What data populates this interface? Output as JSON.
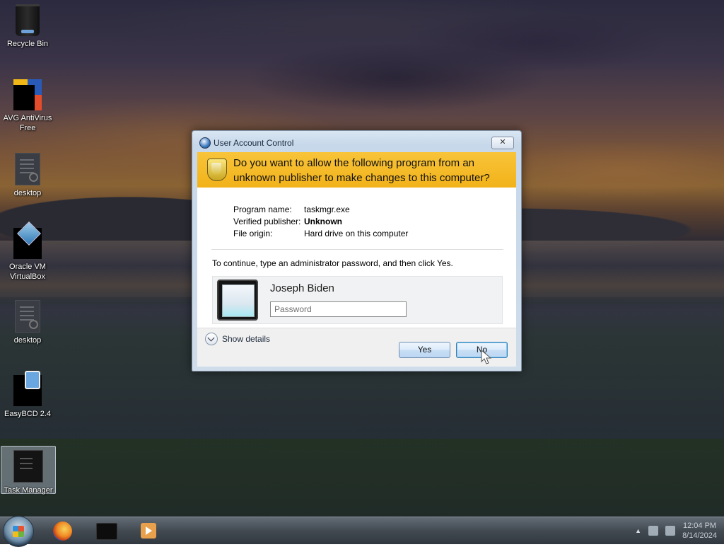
{
  "desktop": {
    "icons": [
      {
        "label": "Recycle Bin"
      },
      {
        "label": "AVG AntiVirus Free"
      },
      {
        "label": "desktop"
      },
      {
        "label": "Oracle VM VirtualBox"
      },
      {
        "label": "desktop"
      },
      {
        "label": "EasyBCD 2.4"
      },
      {
        "label": "Task Manager"
      }
    ]
  },
  "uac": {
    "title": "User Account Control",
    "close_glyph": "✕",
    "question": "Do you want to allow the following program from an unknown publisher to make changes to this computer?",
    "details": {
      "program_name_label": "Program name:",
      "program_name": "taskmgr.exe",
      "publisher_label": "Verified publisher:",
      "publisher": "Unknown",
      "origin_label": "File origin:",
      "origin": "Hard drive on this computer"
    },
    "instruction": "To continue, type an administrator password, and then click Yes.",
    "user": {
      "name": "Joseph Biden"
    },
    "password": {
      "placeholder": "Password",
      "value": ""
    },
    "show_details": "Show details",
    "yes": "Yes",
    "no": "No"
  },
  "taskbar": {
    "apps": [
      "firefox-icon",
      "virtualbox-icon",
      "media-player-icon"
    ],
    "tray_arrow": "▲",
    "clock": {
      "time": "12:04 PM",
      "date": "8/14/2024"
    }
  },
  "colors": {
    "uac_banner": "#f2b219",
    "button_accent": "#3c7fb1"
  }
}
